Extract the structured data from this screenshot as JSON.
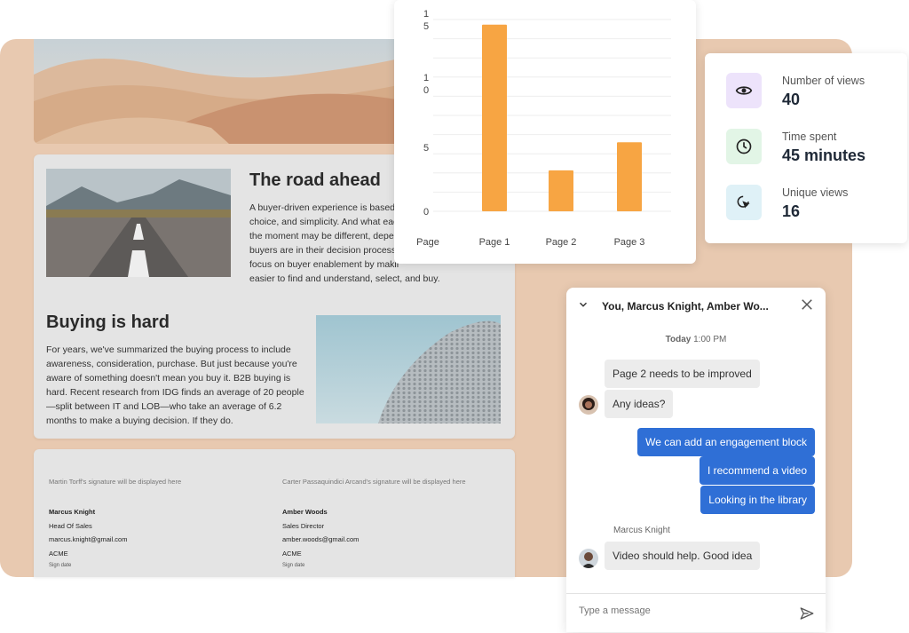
{
  "document": {
    "section1": {
      "heading": "The road ahead",
      "lines": [
        "A buyer-driven experience is based",
        "choice, and simplicity. And what eac",
        "the moment may be different, deper",
        "buyers are in their decision process.",
        "focus on buyer enablement by makir",
        "easier to find and understand, select, and buy."
      ]
    },
    "section2": {
      "heading": "Buying is hard",
      "lines": [
        "For years, we've summarized the buying process to include",
        "awareness, consideration, purchase. But just because you're",
        "aware of something doesn't mean you buy it. B2B buying is",
        "hard. Recent research from IDG finds an average of 20 people",
        "—split between IT and LOB—who take an average of 6.2",
        "months to make a buying decision. If they do."
      ]
    }
  },
  "signatures": [
    {
      "note": "Martin Torff's signature will be displayed here",
      "name": "Marcus Knight",
      "title": "Head Of Sales",
      "email": "marcus.knight@gmail.com",
      "company": "ACME",
      "sign_date_label": "Sign date"
    },
    {
      "note": "Carter Passaquindici Arcand's signature will be displayed here",
      "name": "Amber Woods",
      "title": "Sales Director",
      "email": "amber.woods@gmail.com",
      "company": "ACME",
      "sign_date_label": "Sign date"
    }
  ],
  "chart_data": {
    "type": "bar",
    "categories": [
      "Page 1",
      "Page 2",
      "Page 3"
    ],
    "values": [
      14.6,
      3.2,
      5.4
    ],
    "ylim": [
      0,
      15
    ],
    "y_tick_labels": [
      {
        "value": 0,
        "lines": [
          "0"
        ]
      },
      {
        "value": 5,
        "lines": [
          "5"
        ]
      },
      {
        "value": 10,
        "lines": [
          "1",
          "0"
        ]
      },
      {
        "value": 15,
        "lines": [
          "1",
          "5"
        ]
      }
    ],
    "xlabel": "Page",
    "ylabel": "",
    "title": "",
    "color": "#f7a543",
    "grid": true
  },
  "stats": [
    {
      "label": "Number of views",
      "value": "40",
      "icon": "eye-icon",
      "bg": "#ede3fb"
    },
    {
      "label": "Time spent",
      "value": "45 minutes",
      "icon": "clock-icon",
      "bg": "#e2f5e6"
    },
    {
      "label": "Unique views",
      "value": "16",
      "icon": "cursor-click-icon",
      "bg": "#dff1f7"
    }
  ],
  "chat": {
    "title": "You, Marcus Knight, Amber Wo...",
    "day": "Today",
    "time": "1:00 PM",
    "messages": [
      {
        "text": "Page 2 needs to be improved",
        "dir": "in"
      },
      {
        "text": "Any ideas?",
        "dir": "in"
      },
      {
        "text": "We can add an engagement block",
        "dir": "out"
      },
      {
        "text": "I recommend a video",
        "dir": "out"
      },
      {
        "text": "Looking in the library",
        "dir": "out"
      },
      {
        "text": "Video should help. Good idea",
        "dir": "in"
      }
    ],
    "sender_name": "Marcus Knight",
    "input_placeholder": "Type a message",
    "accent": "#2f6fd6"
  }
}
